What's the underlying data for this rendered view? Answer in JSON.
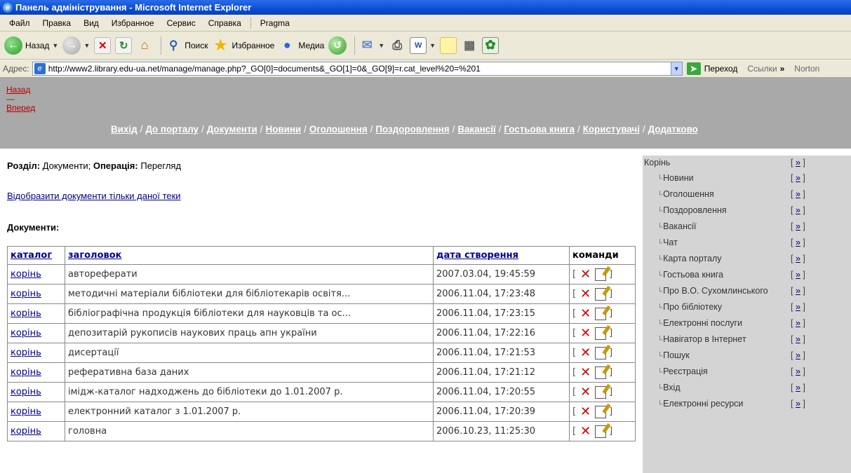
{
  "window": {
    "title": "Панель адміністрування - Microsoft Internet Explorer"
  },
  "menu": [
    "Файл",
    "Правка",
    "Вид",
    "Избранное",
    "Сервис",
    "Справка",
    "Pragma"
  ],
  "toolbar": {
    "back": "Назад",
    "search": "Поиск",
    "favorites": "Избранное",
    "media": "Медиа"
  },
  "address": {
    "label": "Адрес:",
    "url": "http://www2.library.edu-ua.net/manage/manage.php?_GO[0]=documents&_GO[1]=0&_GO[9]=r.cat_level%20=%201",
    "go": "Переход",
    "links": "Ссылки",
    "links_chevron": "»",
    "norton": "Norton"
  },
  "nav": {
    "back": "Назад",
    "dash": "—",
    "forward": "Вперед",
    "separator": "/",
    "links": [
      "Вихід",
      "До порталу",
      "Документи",
      "Новини",
      "Оголошення",
      "Поздоровлення",
      "Вакансії",
      "Гостьова книга",
      "Користувачі",
      "Додатково"
    ]
  },
  "main": {
    "section_label": "Розділ:",
    "section_value": "Документи;",
    "operation_label": "Операція:",
    "operation_value": "Перегляд",
    "show_link": "Відобразити документи тільки даної теки",
    "docs_label": "Документи:"
  },
  "table": {
    "headers": [
      "каталог",
      "заголовок",
      "дата створення",
      "команди"
    ],
    "rows": [
      {
        "catalog": "корінь",
        "title": "автореферати",
        "date": "2007.03.04, 19:45:59"
      },
      {
        "catalog": "корінь",
        "title": "методичні матеріали бібліотеки для бібліотекарів освітя...",
        "date": "2006.11.04, 17:23:48"
      },
      {
        "catalog": "корінь",
        "title": "бібліографічна продукція бібліотеки для науковців та ос...",
        "date": "2006.11.04, 17:23:15"
      },
      {
        "catalog": "корінь",
        "title": "депозитарій рукописів наукових праць апн україни",
        "date": "2006.11.04, 17:22:16"
      },
      {
        "catalog": "корінь",
        "title": "дисертації",
        "date": "2006.11.04, 17:21:53"
      },
      {
        "catalog": "корінь",
        "title": "реферативна база даних",
        "date": "2006.11.04, 17:21:12"
      },
      {
        "catalog": "корінь",
        "title": "імідж-каталог надходжень до бібліотеки до 1.01.2007 р.",
        "date": "2006.11.04, 17:20:55"
      },
      {
        "catalog": "корінь",
        "title": "електронний каталог з 1.01.2007 р.",
        "date": "2006.11.04, 17:20:39"
      },
      {
        "catalog": "корінь",
        "title": "головна",
        "date": "2006.10.23, 11:25:30"
      }
    ],
    "cmd_open": "[",
    "cmd_close": "]"
  },
  "sidebar": {
    "root": "Корінь",
    "btn_open": "[",
    "btn_link": "»",
    "btn_close": "]",
    "items": [
      "Новини",
      "Оголошення",
      "Поздоровлення",
      "Вакансії",
      "Чат",
      "Карта порталу",
      "Гостьова книга",
      "Про В.О. Сухомлинського",
      "Про бібліотеку",
      "Електронні послуги",
      "Навігатор в Інтернет",
      "Пошук",
      "Реєстрація",
      "Вхід",
      "Електронні ресурси"
    ]
  },
  "colors": {
    "nav_bg": "#a9a9a9",
    "sidebar_bg": "#d4d4d4",
    "link": "#00008b",
    "delete": "#d40000"
  }
}
